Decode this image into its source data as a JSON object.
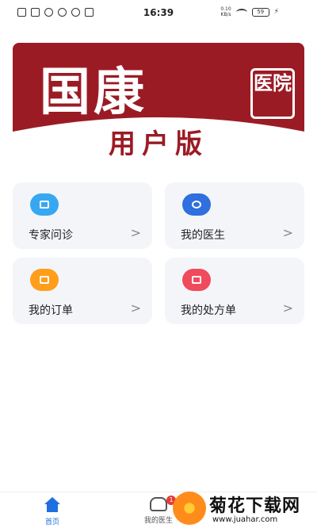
{
  "status_bar": {
    "time": "16:39",
    "net_speed": "0.10\nKB/s",
    "battery": "59"
  },
  "banner": {
    "title": "国康",
    "badge": "医院",
    "subtitle": "用户版"
  },
  "cards": [
    {
      "label": "专家问诊",
      "icon": "consult-icon",
      "color": "#36a8f2"
    },
    {
      "label": "我的医生",
      "icon": "doctor-icon",
      "color": "#2f6fde"
    },
    {
      "label": "我的订单",
      "icon": "order-icon",
      "color": "#ff9e1b"
    },
    {
      "label": "我的处方单",
      "icon": "prescription-icon",
      "color": "#ef4b5c"
    }
  ],
  "arrow": ">",
  "tabbar": {
    "home_label": "首页",
    "doctor_label": "我的医生",
    "doctor_badge": "1"
  },
  "watermark": {
    "text": "菊花下载网",
    "url": "www.juahar.com"
  },
  "colors": {
    "banner_red": "#9b1b25",
    "active_tab": "#1f6fe0"
  }
}
